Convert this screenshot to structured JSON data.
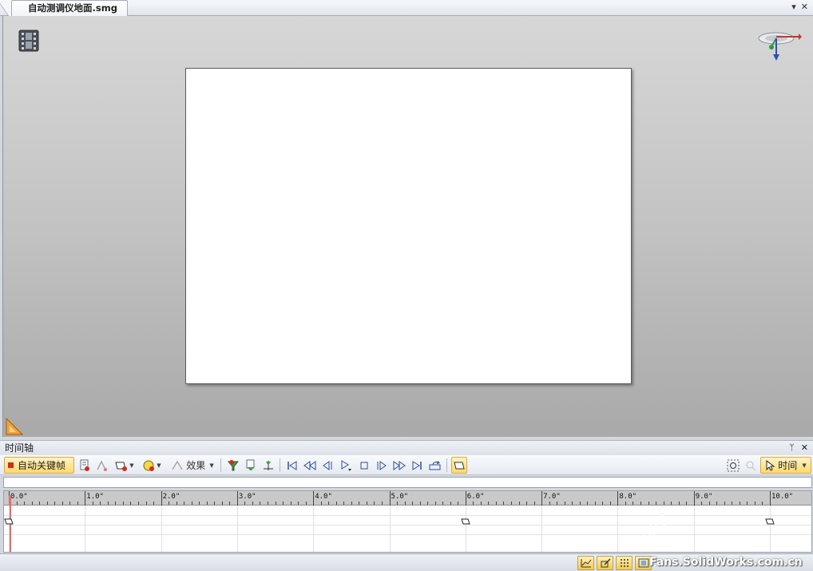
{
  "document": {
    "tab_title": "自动测调仪地面.smg",
    "window_controls": {
      "menu": "▾",
      "close": "✕"
    }
  },
  "timeline": {
    "panel_title": "时间轴",
    "panel_controls": {
      "pin": "ᛘ",
      "close": "✕"
    },
    "auto_key_label": "自动关键帧",
    "effects_label": "效果",
    "time_label": "时间",
    "ruler_labels": [
      "0.0\"",
      "1.0\"",
      "2.0\"",
      "3.0\"",
      "4.0\"",
      "5.0\"",
      "6.0\"",
      "7.0\"",
      "8.0\"",
      "9.0\"",
      "10.0\""
    ],
    "keyframes_seconds": [
      0.0,
      6.0,
      10.0
    ]
  },
  "statusbar": {
    "watermark": "Fans.SolidWorks.com.cn"
  },
  "colors": {
    "accent_yellow": "#ffd96a",
    "playhead": "#e86a6a",
    "record_red": "#d42b1e"
  }
}
